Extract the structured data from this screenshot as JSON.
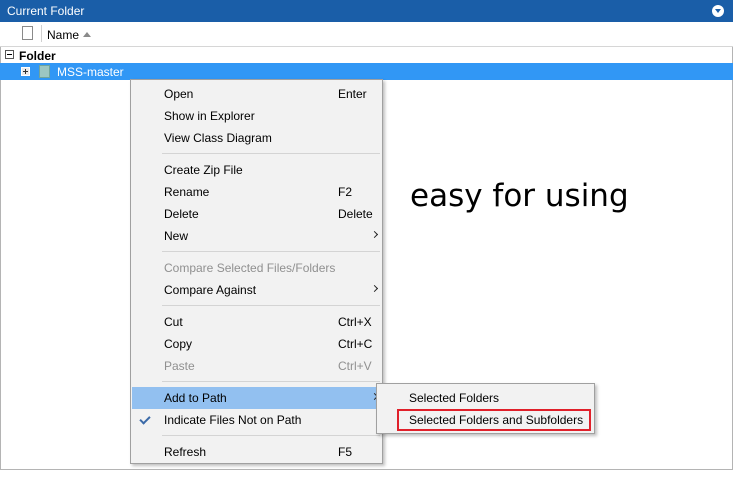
{
  "panel": {
    "title": "Current Folder",
    "column_name": "Name",
    "group_label": "Folder",
    "selected_folder": "MSS-master"
  },
  "annotation_text": "easy for using",
  "context_menu": {
    "items": [
      {
        "label": "Open",
        "shortcut": "Enter"
      },
      {
        "label": "Show in Explorer",
        "shortcut": ""
      },
      {
        "label": "View Class Diagram",
        "shortcut": ""
      },
      {
        "label": "Create Zip File",
        "shortcut": ""
      },
      {
        "label": "Rename",
        "shortcut": "F2"
      },
      {
        "label": "Delete",
        "shortcut": "Delete"
      },
      {
        "label": "New",
        "shortcut": ""
      },
      {
        "label": "Compare Selected Files/Folders",
        "shortcut": ""
      },
      {
        "label": "Compare Against",
        "shortcut": ""
      },
      {
        "label": "Cut",
        "shortcut": "Ctrl+X"
      },
      {
        "label": "Copy",
        "shortcut": "Ctrl+C"
      },
      {
        "label": "Paste",
        "shortcut": "Ctrl+V"
      },
      {
        "label": "Add to Path",
        "shortcut": ""
      },
      {
        "label": "Indicate Files Not on Path",
        "shortcut": ""
      },
      {
        "label": "Refresh",
        "shortcut": "F5"
      }
    ]
  },
  "submenu": {
    "items": [
      {
        "label": "Selected Folders"
      },
      {
        "label": "Selected Folders and Subfolders"
      }
    ]
  },
  "colors": {
    "titlebar": "#1a5ea8",
    "selection": "#3197f5",
    "menu_hover": "#92c0f0",
    "highlight_box": "#e0202a"
  }
}
